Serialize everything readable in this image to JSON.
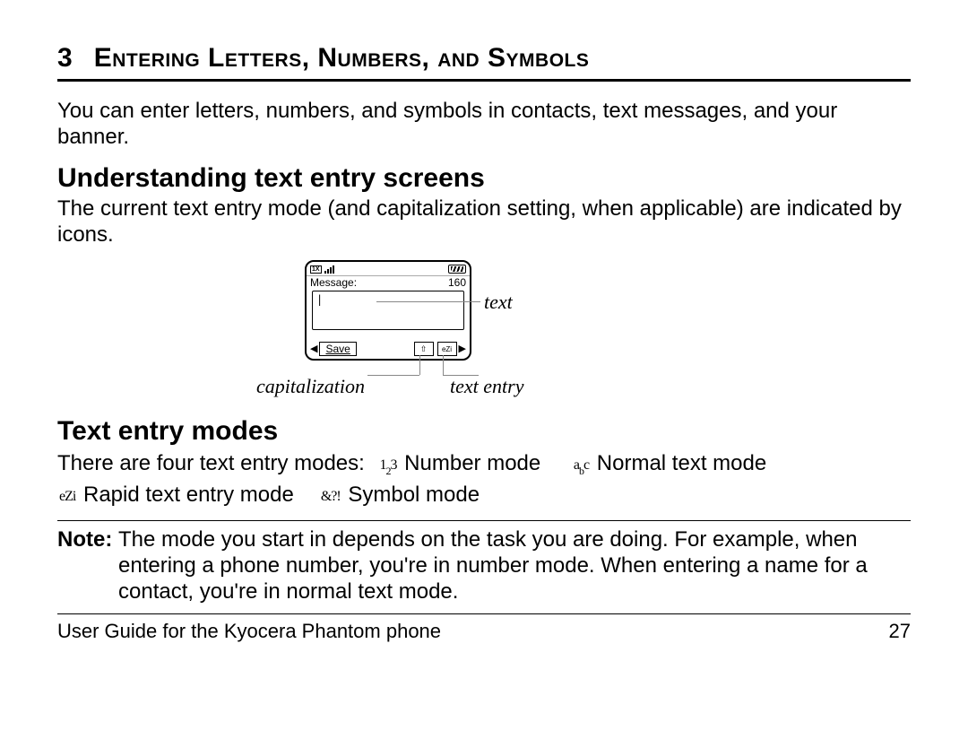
{
  "chapter": {
    "number": "3",
    "title": "Entering Letters, Numbers, and Symbols"
  },
  "intro": "You can enter letters, numbers, and symbols in contacts, text messages, and your banner.",
  "section1": {
    "heading": "Understanding text entry screens",
    "body": "The current text entry mode (and capitalization setting, when applicable) are indicated by icons."
  },
  "phone": {
    "message_label": "Message:",
    "char_count": "160",
    "cursor": "|",
    "save_label": "Save",
    "icon_cap": "⇧",
    "icon_ezi": "eZi"
  },
  "callouts": {
    "text": "text",
    "capitalization": "capitalization",
    "text_entry": "text entry"
  },
  "section2": {
    "heading": "Text entry modes",
    "lead": "There are four text entry modes:",
    "modes": {
      "number_icon_html": "1<sub>2</sub>3",
      "number_label": "Number mode",
      "normal_icon_html": "a<sub>b</sub>c",
      "normal_label": "Normal text mode",
      "rapid_icon": "eZi",
      "rapid_label": "Rapid text entry mode",
      "symbol_icon": "&?!",
      "symbol_label": "Symbol mode"
    }
  },
  "note": {
    "label": "Note: ",
    "body": "The mode you start in depends on the task you are doing. For example, when entering a phone number, you're in number mode. When entering a name for a contact, you're in normal text mode."
  },
  "footer": {
    "left": "User Guide for the Kyocera Phantom phone",
    "right": "27"
  }
}
